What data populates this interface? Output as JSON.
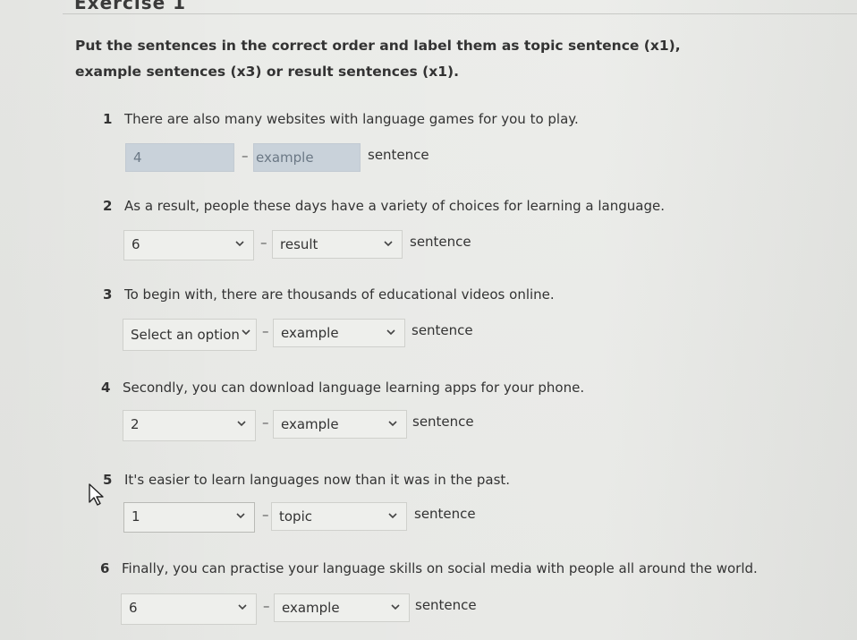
{
  "exercise": {
    "title": "Exercise 1",
    "instructions": "Put the sentences in the correct order and label them as topic sentence (x1), example sentences (x3) or result sentences (x1)."
  },
  "questions": [
    {
      "number": "1",
      "text": "There are also many websites with language games for you to play.",
      "order": "4",
      "type": "example",
      "suffix": "sentence"
    },
    {
      "number": "2",
      "text": "As a result, people these days have a variety of choices for learning a language.",
      "order": "6",
      "type": "result",
      "suffix": "sentence"
    },
    {
      "number": "3",
      "text": "To begin with, there are thousands of educational videos online.",
      "order": "Select an option",
      "type": "example",
      "suffix": "sentence"
    },
    {
      "number": "4",
      "text": "Secondly, you can download language learning apps for your phone.",
      "order": "2",
      "type": "example",
      "suffix": "sentence"
    },
    {
      "number": "5",
      "text": "It's easier to learn languages now than it was in the past.",
      "order": "1",
      "type": "topic",
      "suffix": "sentence"
    },
    {
      "number": "6",
      "text": "Finally, you can practise your language skills on social media with people all around the world.",
      "order": "6",
      "type": "example",
      "suffix": "sentence"
    }
  ],
  "separator": "–",
  "icons": {
    "dropdown": "chevron-down-icon",
    "cursor": "mouse-pointer-icon"
  },
  "colors": {
    "highlight": "#c9d2da"
  }
}
